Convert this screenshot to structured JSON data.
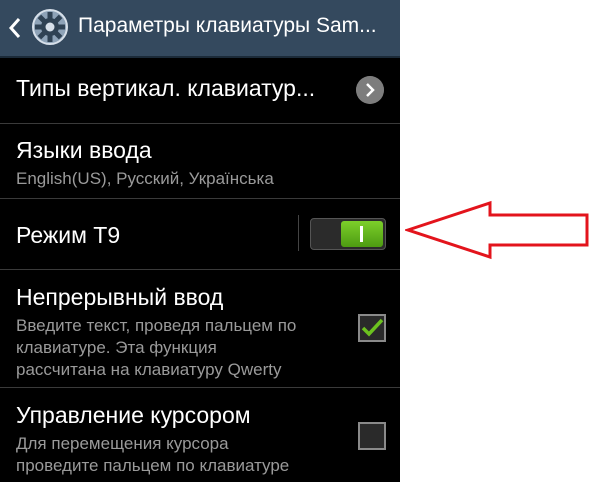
{
  "header": {
    "title": "Параметры клавиатуры Sam...",
    "back_icon": "chevron-left-icon",
    "app_icon": "gear-icon",
    "background": "#34495e"
  },
  "settings": [
    {
      "title": "Типы вертикал. клавиатур..."
    },
    {
      "title": "Языки ввода",
      "subtitle": "English(US), Русский, Українська"
    },
    {
      "title": "Режим Т9",
      "toggle_on": true
    },
    {
      "title": "Непрерывный ввод",
      "subtitle_lines": [
        "Введите текст, проведя пальцем по",
        "клавиатуре. Эта функция",
        "рассчитана на клавиатуру Qwerty"
      ],
      "checked": true
    },
    {
      "title": "Управление курсором",
      "subtitle_lines": [
        "Для перемещения курсора",
        "проведите пальцем по клавиатуре"
      ],
      "checked": false
    }
  ],
  "colors": {
    "accent_green": "#6cc21f",
    "annotation_red": "#e3141c"
  },
  "annotation": {
    "icon": "red-arrow-icon"
  }
}
